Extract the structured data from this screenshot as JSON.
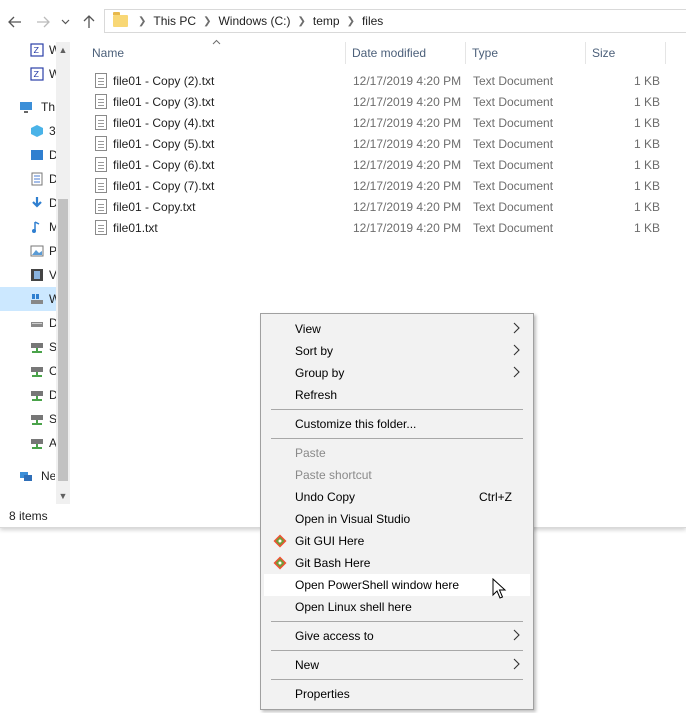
{
  "address": {
    "crumbs": [
      "This PC",
      "Windows (C:)",
      "temp",
      "files"
    ]
  },
  "navpane": {
    "items": [
      {
        "label": "W",
        "icon": "zip-folder-icon"
      },
      {
        "label": "W",
        "icon": "zip-folder-icon"
      },
      {
        "label": "Th",
        "icon": "this-pc-icon"
      },
      {
        "label": "3",
        "icon": "3d-objects-icon"
      },
      {
        "label": "D",
        "icon": "desktop-icon"
      },
      {
        "label": "D",
        "icon": "documents-icon"
      },
      {
        "label": "D",
        "icon": "downloads-icon"
      },
      {
        "label": "M",
        "icon": "music-icon"
      },
      {
        "label": "P",
        "icon": "pictures-icon"
      },
      {
        "label": "V",
        "icon": "videos-icon"
      },
      {
        "label": "W",
        "icon": "windows-drive-icon"
      },
      {
        "label": "D",
        "icon": "drive-icon"
      },
      {
        "label": "S",
        "icon": "network-drive-icon"
      },
      {
        "label": "C",
        "icon": "network-drive-icon"
      },
      {
        "label": "D",
        "icon": "network-drive-icon"
      },
      {
        "label": "S",
        "icon": "network-drive-icon"
      },
      {
        "label": "A",
        "icon": "network-drive-icon"
      },
      {
        "label": "Ne",
        "icon": "network-icon"
      }
    ]
  },
  "filelist": {
    "columns": {
      "name": "Name",
      "date": "Date modified",
      "type": "Type",
      "size": "Size"
    },
    "rows": [
      {
        "name": "file01 - Copy (2).txt",
        "date": "12/17/2019 4:20 PM",
        "type": "Text Document",
        "size": "1 KB"
      },
      {
        "name": "file01 - Copy (3).txt",
        "date": "12/17/2019 4:20 PM",
        "type": "Text Document",
        "size": "1 KB"
      },
      {
        "name": "file01 - Copy (4).txt",
        "date": "12/17/2019 4:20 PM",
        "type": "Text Document",
        "size": "1 KB"
      },
      {
        "name": "file01 - Copy (5).txt",
        "date": "12/17/2019 4:20 PM",
        "type": "Text Document",
        "size": "1 KB"
      },
      {
        "name": "file01 - Copy (6).txt",
        "date": "12/17/2019 4:20 PM",
        "type": "Text Document",
        "size": "1 KB"
      },
      {
        "name": "file01 - Copy (7).txt",
        "date": "12/17/2019 4:20 PM",
        "type": "Text Document",
        "size": "1 KB"
      },
      {
        "name": "file01 - Copy.txt",
        "date": "12/17/2019 4:20 PM",
        "type": "Text Document",
        "size": "1 KB"
      },
      {
        "name": "file01.txt",
        "date": "12/17/2019 4:20 PM",
        "type": "Text Document",
        "size": "1 KB"
      }
    ]
  },
  "status": {
    "items": "8 items"
  },
  "context_menu": {
    "view": "View",
    "sort_by": "Sort by",
    "group_by": "Group by",
    "refresh": "Refresh",
    "customize": "Customize this folder...",
    "paste": "Paste",
    "paste_shortcut": "Paste shortcut",
    "undo_copy": "Undo Copy",
    "undo_shortcut": "Ctrl+Z",
    "open_vs": "Open in Visual Studio",
    "git_gui": "Git GUI Here",
    "git_bash": "Git Bash Here",
    "open_powershell": "Open PowerShell window here",
    "open_linux": "Open Linux shell here",
    "give_access": "Give access to",
    "new": "New",
    "properties": "Properties"
  },
  "colors": {
    "accent": "#cce8ff",
    "git": "#f05133",
    "git_green": "#5aab3b"
  }
}
